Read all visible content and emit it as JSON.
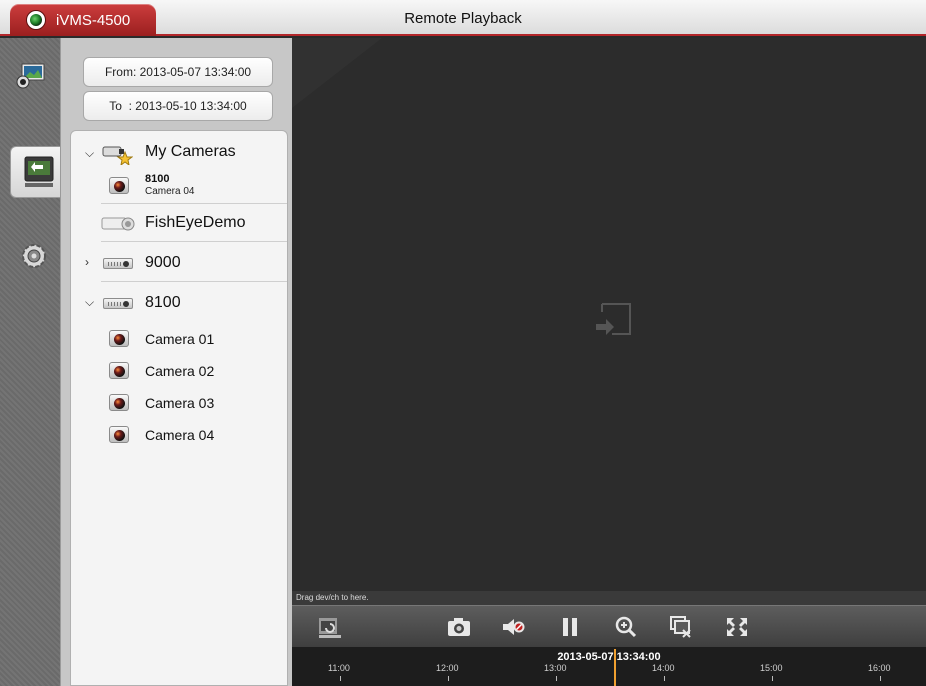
{
  "app": {
    "name": "iVMS-4500",
    "window_title": "Remote Playback"
  },
  "nav": {
    "items": [
      {
        "name": "live-view",
        "icon": "live-view-icon"
      },
      {
        "name": "remote-playback",
        "icon": "playback-icon",
        "selected": true
      },
      {
        "name": "settings",
        "icon": "gear-icon"
      }
    ]
  },
  "time_range": {
    "from": "From: 2013-05-07 13:34:00",
    "to": "To  : 2013-05-10 13:34:00"
  },
  "tree": {
    "my_cameras": {
      "label": "My Cameras",
      "favorite": {
        "name": "8100",
        "sub": "Camera 04"
      }
    },
    "fisheye": {
      "label": "FishEyeDemo"
    },
    "group_9000": {
      "label": "9000"
    },
    "group_8100": {
      "label": "8100",
      "cameras": [
        "Camera 01",
        "Camera 02",
        "Camera 03",
        "Camera 04"
      ]
    }
  },
  "video": {
    "drag_hint": "Drag dev/ch to here."
  },
  "toolbar": {
    "buttons": [
      "playback-type-icon",
      "snapshot-icon",
      "mute-icon",
      "pause-icon",
      "zoom-in-icon",
      "stop-all-icon",
      "fullscreen-icon"
    ]
  },
  "timeline": {
    "cursor": "2013-05-07 13:34:00",
    "ticks": [
      "11:00",
      "12:00",
      "13:00",
      "14:00",
      "15:00",
      "16:00"
    ]
  },
  "colors": {
    "accent": "#b3262a",
    "cursor": "#f0a030"
  }
}
